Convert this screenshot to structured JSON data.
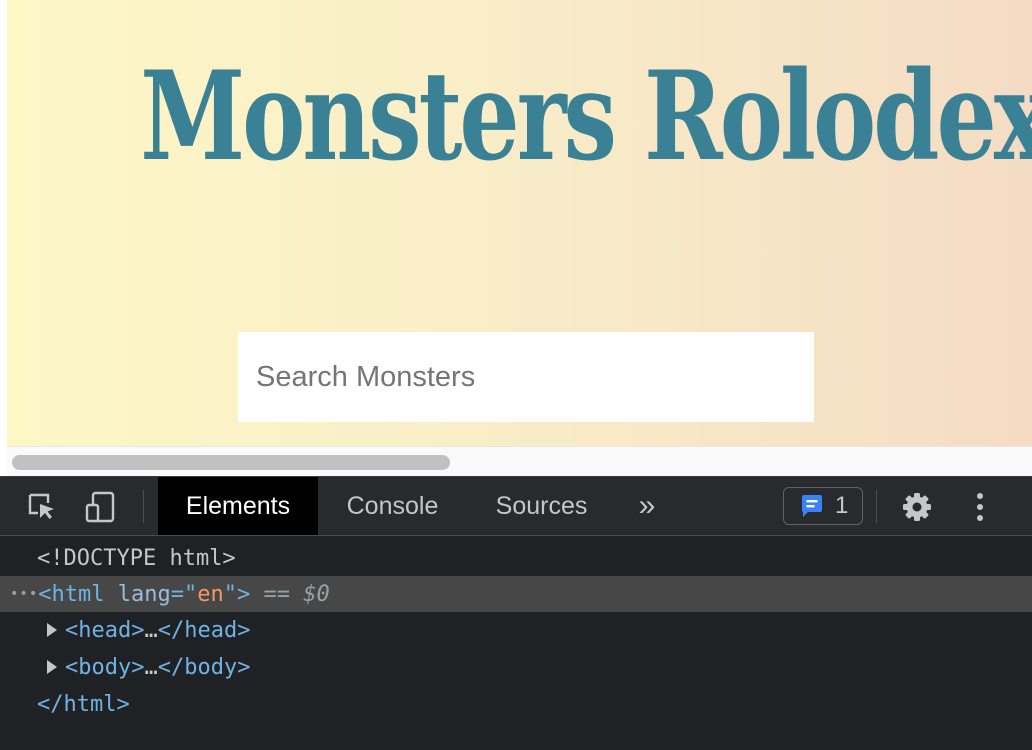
{
  "page": {
    "title": "Monsters Rolodex",
    "search": {
      "placeholder": "Search Monsters",
      "value": ""
    }
  },
  "devtools": {
    "tabs": [
      {
        "label": "Elements",
        "active": true
      },
      {
        "label": "Console",
        "active": false
      },
      {
        "label": "Sources",
        "active": false
      }
    ],
    "more_tabs": "»",
    "issues_count": "1",
    "icons": [
      "inspect-element-icon",
      "device-toolbar-icon",
      "more-tabs-icon",
      "issues-message-icon",
      "settings-gear-icon",
      "kebab-menu-icon"
    ],
    "dom": {
      "doctype": "<!DOCTYPE html>",
      "html_open": "<html",
      "lang_attr": "lang",
      "lang_eq": "=\"",
      "lang_value": "en",
      "lang_close": "\">",
      "selected_eq": "==",
      "selected_var": "$0",
      "head": {
        "open": "<head>",
        "ellipsis": "…",
        "close": "</head>"
      },
      "body": {
        "open": "<body>",
        "ellipsis": "…",
        "close": "</body>"
      },
      "html_close": "</html>"
    }
  },
  "colors": {
    "title": "#3b8195",
    "active_tab_bg": "#000000",
    "devtools_bg": "#202124",
    "issues_icon": "#3b82f6"
  }
}
